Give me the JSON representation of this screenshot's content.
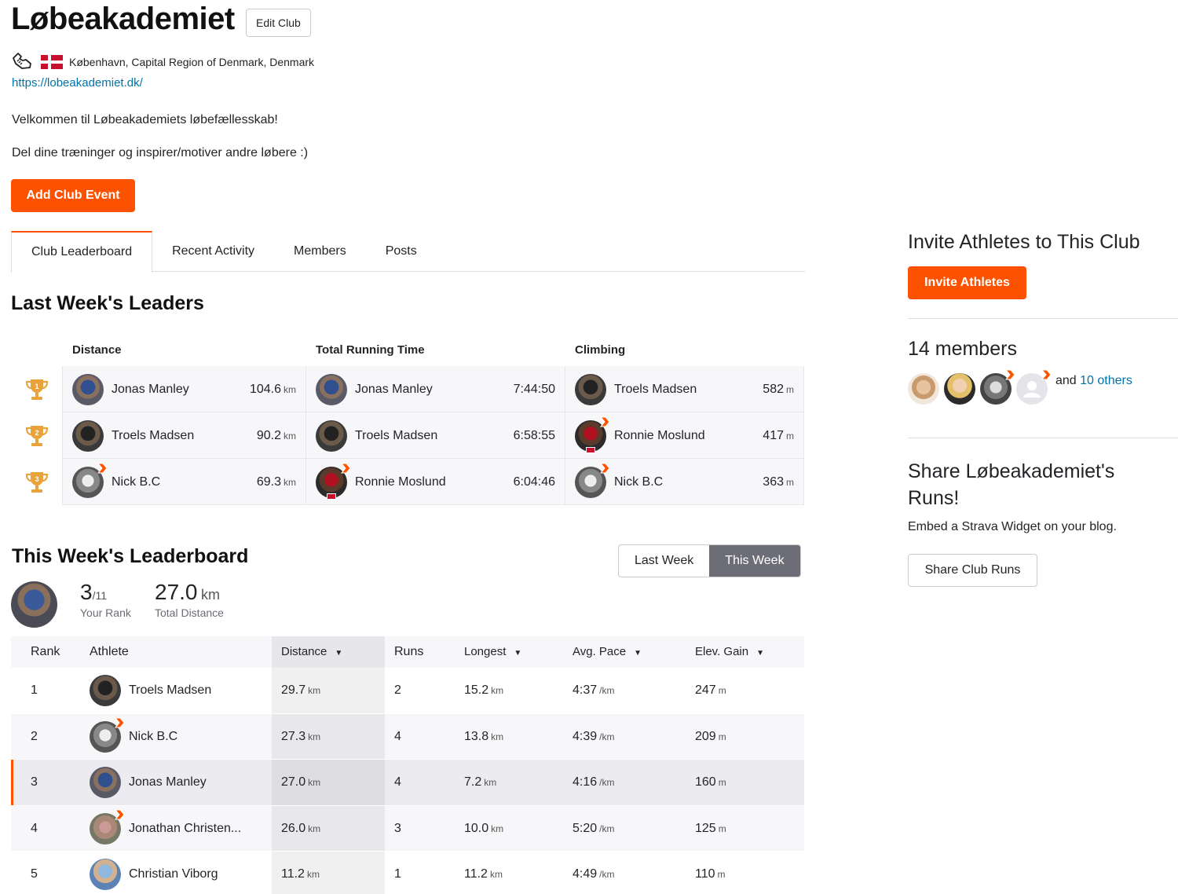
{
  "club": {
    "name": "Løbeakademiet",
    "edit_label": "Edit Club",
    "location": "København, Capital Region of Denmark, Denmark",
    "url": "https://lobeakademiet.dk/",
    "description_1": "Velkommen til Løbeakademiets løbefællesskab!",
    "description_2": "Del dine træninger og inspirer/motiver andre løbere :)",
    "add_event_label": "Add Club Event"
  },
  "tabs": [
    "Club Leaderboard",
    "Recent Activity",
    "Members",
    "Posts"
  ],
  "leaders": {
    "title": "Last Week's Leaders",
    "headers": {
      "distance": "Distance",
      "time": "Total Running Time",
      "climbing": "Climbing"
    },
    "rows": [
      {
        "place": "1",
        "distance": {
          "name": "Jonas Manley",
          "value": "104.6",
          "unit": "km"
        },
        "time": {
          "name": "Jonas Manley",
          "value": "7:44:50"
        },
        "climbing": {
          "name": "Troels Madsen",
          "value": "582",
          "unit": "m"
        }
      },
      {
        "place": "2",
        "distance": {
          "name": "Troels Madsen",
          "value": "90.2",
          "unit": "km"
        },
        "time": {
          "name": "Troels Madsen",
          "value": "6:58:55"
        },
        "climbing": {
          "name": "Ronnie Moslund",
          "value": "417",
          "unit": "m"
        }
      },
      {
        "place": "3",
        "distance": {
          "name": "Nick B.C",
          "value": "69.3",
          "unit": "km"
        },
        "time": {
          "name": "Ronnie Moslund",
          "value": "6:04:46"
        },
        "climbing": {
          "name": "Nick B.C",
          "value": "363",
          "unit": "m"
        }
      }
    ]
  },
  "this_week": {
    "title": "This Week's Leaderboard",
    "toggle": {
      "last_week": "Last Week",
      "this_week": "This Week"
    },
    "my_rank": "3",
    "my_rank_of": "/11",
    "my_rank_label": "Your Rank",
    "total_distance": "27.0",
    "total_distance_unit": "km",
    "total_distance_label": "Total Distance",
    "columns": {
      "rank": "Rank",
      "athlete": "Athlete",
      "distance": "Distance",
      "runs": "Runs",
      "longest": "Longest",
      "pace": "Avg. Pace",
      "elev": "Elev. Gain"
    },
    "rows": [
      {
        "rank": "1",
        "athlete": "Troels Madsen",
        "distance": "29.7",
        "runs": "2",
        "longest": "15.2",
        "pace": "4:37",
        "elev": "247"
      },
      {
        "rank": "2",
        "athlete": "Nick B.C",
        "distance": "27.3",
        "runs": "4",
        "longest": "13.8",
        "pace": "4:39",
        "elev": "209"
      },
      {
        "rank": "3",
        "athlete": "Jonas Manley",
        "distance": "27.0",
        "runs": "4",
        "longest": "7.2",
        "pace": "4:16",
        "elev": "160"
      },
      {
        "rank": "4",
        "athlete": "Jonathan Christen...",
        "distance": "26.0",
        "runs": "3",
        "longest": "10.0",
        "pace": "5:20",
        "elev": "125"
      },
      {
        "rank": "5",
        "athlete": "Christian Viborg",
        "distance": "11.2",
        "runs": "1",
        "longest": "11.2",
        "pace": "4:49",
        "elev": "110"
      }
    ],
    "units": {
      "distance": "km",
      "pace": "/km",
      "elev": "m"
    }
  },
  "sidebar": {
    "invite_title": "Invite Athletes to This Club",
    "invite_label": "Invite Athletes",
    "members_title": "14 members",
    "and_label": "and",
    "others_label": "10 others",
    "share_title": "Share Løbeakademiet's Runs!",
    "share_sub": "Embed a Strava Widget on your blog.",
    "share_label": "Share Club Runs"
  },
  "colors": {
    "accent": "#fc5200",
    "link": "#0073a8",
    "trophy": "#e8a33b"
  },
  "icons": [
    "running-shoe-icon",
    "denmark-flag-icon",
    "trophy-icon",
    "strava-badge-icon",
    "sort-arrow-icon"
  ]
}
